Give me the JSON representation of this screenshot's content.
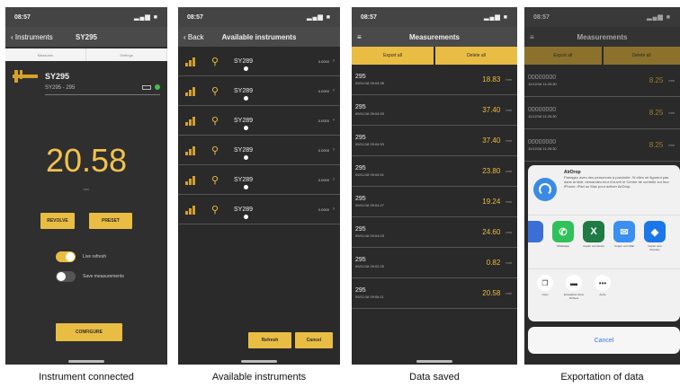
{
  "captions": [
    "Instrument connected",
    "Available instruments",
    "Data saved",
    "Exportation of data"
  ],
  "status": {
    "time": "08:57",
    "signal": "▂▄▆ ■"
  },
  "panel1": {
    "back_label": "Instruments",
    "title": "SY295",
    "segments": [
      "Measures",
      "Settings"
    ],
    "device_name": "SY295",
    "device_sub": "SY295 - 295",
    "value": "20.58",
    "unit": "mm",
    "buttons": [
      "REVOLVE",
      "PRESET"
    ],
    "toggles": [
      {
        "label": "Live refresh",
        "on": true
      },
      {
        "label": "Save measurements",
        "on": false
      }
    ],
    "configure_label": "CONFIGURE"
  },
  "panel2": {
    "back_label": "Back",
    "title": "Available instruments",
    "instruments": [
      {
        "name": "SY289",
        "value": "0.0000"
      },
      {
        "name": "SY289",
        "value": "0.0000"
      },
      {
        "name": "SY289",
        "value": "0.0000"
      },
      {
        "name": "SY289",
        "value": "0.0000"
      },
      {
        "name": "SY289",
        "value": "0.0000"
      },
      {
        "name": "SY289",
        "value": "0.0000"
      }
    ],
    "refresh_label": "Refresh",
    "cancel_label": "Cancel"
  },
  "panel3": {
    "menu_icon": "≡",
    "title": "Measurements",
    "header_buttons": [
      "Export all",
      "Delete all"
    ],
    "rows": [
      {
        "id": "295",
        "ts": "09/11/18 09:04:38",
        "value": "18.83",
        "unit": "mm"
      },
      {
        "id": "295",
        "ts": "09/11/18 09:04:53",
        "value": "37.40",
        "unit": "mm"
      },
      {
        "id": "295",
        "ts": "09/11/18 09:04:53",
        "value": "37.40",
        "unit": "mm"
      },
      {
        "id": "295",
        "ts": "09/11/18 09:04:51",
        "value": "23.80",
        "unit": "mm"
      },
      {
        "id": "295",
        "ts": "09/11/18 09:04:27",
        "value": "19.24",
        "unit": "mm"
      },
      {
        "id": "295",
        "ts": "09/11/18 09:04:03",
        "value": "24.60",
        "unit": "mm"
      },
      {
        "id": "295",
        "ts": "09/11/18 09:02:20",
        "value": "0.82",
        "unit": "mm"
      },
      {
        "id": "295",
        "ts": "09/11/18 09:06:11",
        "value": "20.58",
        "unit": "mm"
      }
    ]
  },
  "panel4": {
    "menu_icon": "≡",
    "title": "Measurements",
    "header_buttons": [
      "Export all",
      "Delete all"
    ],
    "rows": [
      {
        "id": "00000000",
        "ts": "11/12/18 11:25:30",
        "value": "8.25",
        "unit": "mm"
      },
      {
        "id": "00000000",
        "ts": "11/12/18 11:25:30",
        "value": "8.25",
        "unit": "mm"
      },
      {
        "id": "00000000",
        "ts": "11/12/18 11:25:30",
        "value": "8.25",
        "unit": "mm"
      }
    ],
    "airdrop_title": "AirDrop",
    "airdrop_text": "Partagez avec des personnes à proximité. Si elles ne figurent pas dans la liste, demandez-leur d'ouvrir le Centre de contrôle sur leur iPhone, iPad ou Mac pour activer AirDrop.",
    "apps": [
      {
        "label": "",
        "color": "#3b6fd8",
        "glyph": ""
      },
      {
        "label": "WhatsApp",
        "color": "#30c15a",
        "glyph": "✆"
      },
      {
        "label": "Copier vers Excel",
        "color": "#1f7a44",
        "glyph": "X"
      },
      {
        "label": "Copier vers Mail",
        "color": "#3a8ff0",
        "glyph": "✉"
      },
      {
        "label": "Copier vers Dropbox",
        "color": "#1b76e8",
        "glyph": "◆"
      }
    ],
    "actions": [
      {
        "label": "Copy",
        "glyph": "❐"
      },
      {
        "label": "Enregistrer dans Fichiers",
        "glyph": "▬"
      },
      {
        "label": "Autre",
        "glyph": "•••"
      }
    ],
    "cancel_label": "Cancel"
  }
}
